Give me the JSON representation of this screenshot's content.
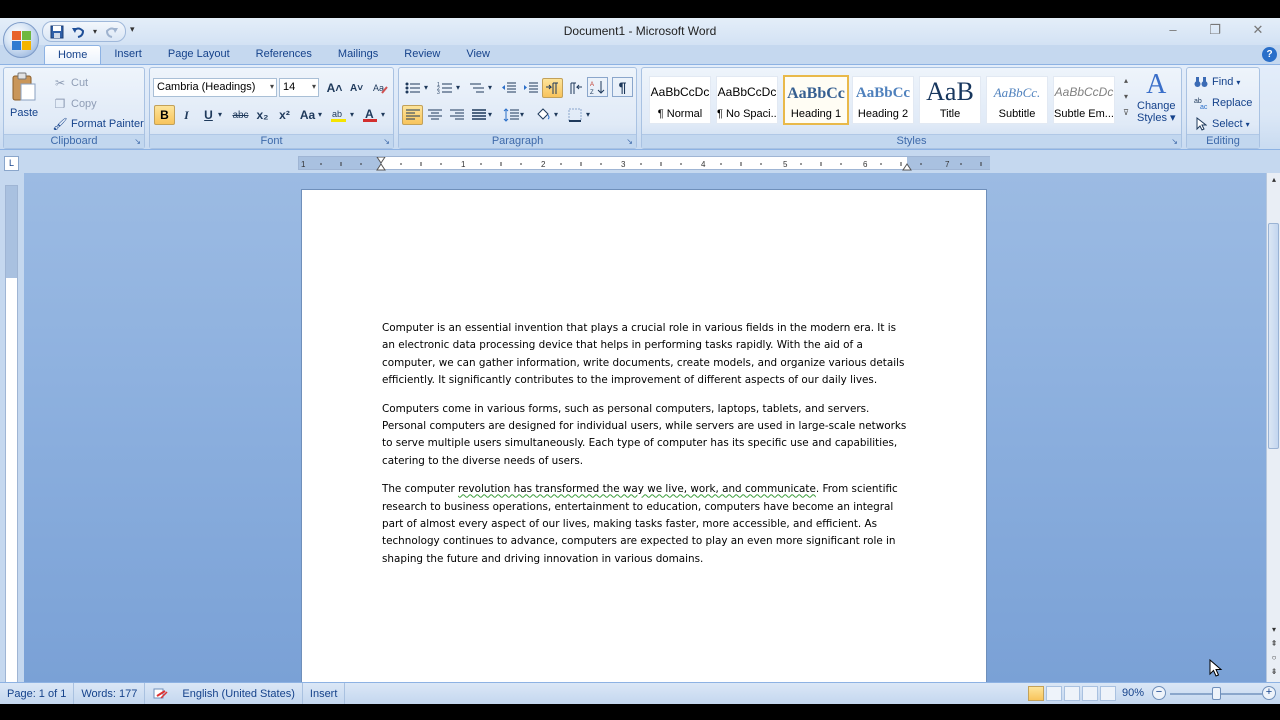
{
  "window": {
    "title": "Document1 - Microsoft Word",
    "minimize": "–",
    "maximize": "❐",
    "close": "✕"
  },
  "qat": {
    "more": "▾"
  },
  "tabs": [
    {
      "label": "Home",
      "active": true
    },
    {
      "label": "Insert"
    },
    {
      "label": "Page Layout"
    },
    {
      "label": "References"
    },
    {
      "label": "Mailings"
    },
    {
      "label": "Review"
    },
    {
      "label": "View"
    }
  ],
  "help": "?",
  "clipboard": {
    "group": "Clipboard",
    "paste": "Paste",
    "cut": "Cut",
    "copy": "Copy",
    "format_painter": "Format Painter"
  },
  "font": {
    "group": "Font",
    "name": "Cambria (Headings)",
    "size": "14",
    "bold": "B",
    "italic": "I",
    "underline": "U",
    "strike": "abc",
    "subscript": "x₂",
    "superscript": "x²",
    "change_case": "Aa",
    "grow": "A˄",
    "shrink": "A˅",
    "font_color_letter": "A",
    "font_color": "#d32f2f",
    "highlight_color": "#f5e400"
  },
  "paragraph": {
    "group": "Paragraph",
    "pilcrow": "¶"
  },
  "styles": {
    "group": "Styles",
    "items": [
      {
        "preview": "AaBbCcDc",
        "name": "¶ Normal"
      },
      {
        "preview": "AaBbCcDc",
        "name": "¶ No Spaci..."
      },
      {
        "preview": "AaBbCc",
        "name": "Heading 1",
        "selected": true
      },
      {
        "preview": "AaBbCc",
        "name": "Heading 2"
      },
      {
        "preview": "AaB",
        "name": "Title"
      },
      {
        "preview": "AaBbCc.",
        "name": "Subtitle"
      },
      {
        "preview": "AaBbCcDc",
        "name": "Subtle Em..."
      }
    ],
    "change_styles_1": "Change",
    "change_styles_2": "Styles",
    "change_styles_arrow": "▾"
  },
  "editing": {
    "group": "Editing",
    "find": "Find",
    "replace": "Replace",
    "select": "Select"
  },
  "ruler": {
    "corner": "L",
    "labels": [
      "1",
      "1",
      "2",
      "3",
      "4",
      "5",
      "6",
      "7"
    ]
  },
  "document": {
    "paragraphs": [
      "Computer is an essential invention that plays a crucial role in various fields in the modern era. It is an electronic data processing device that helps in performing tasks rapidly. With the aid of a computer, we can gather information, write documents, create models, and organize various details efficiently. It significantly contributes to the improvement of different aspects of our daily lives.",
      "Computers come in various forms, such as personal computers, laptops, tablets, and servers. Personal computers are designed for individual users, while servers are used in large-scale networks to serve multiple users simultaneously.  Each type of computer has its specific use and capabilities, catering to the diverse needs of users."
    ],
    "p3_start": "The computer ",
    "p3_flagged": "revolution has transformed the way we live, work, and communicate",
    "p3_rest": ". From scientific research to business operations, entertainment to education, computers have become an integral part of almost every aspect of our lives, making tasks faster, more accessible, and efficient. As technology continues to advance, computers are expected to play an even more significant role in shaping the future and driving innovation in various domains."
  },
  "statusbar": {
    "page": "Page: 1 of 1",
    "words": "Words: 177",
    "language": "English (United States)",
    "mode": "Insert",
    "zoom": "90%",
    "zoom_minus": "−",
    "zoom_plus": "+",
    "zoom_level_fraction": 0.5
  },
  "colors": {
    "accent": "#2a6fc9",
    "ribbon": "#dbe7f6",
    "selected_style": "#e9b94a"
  }
}
